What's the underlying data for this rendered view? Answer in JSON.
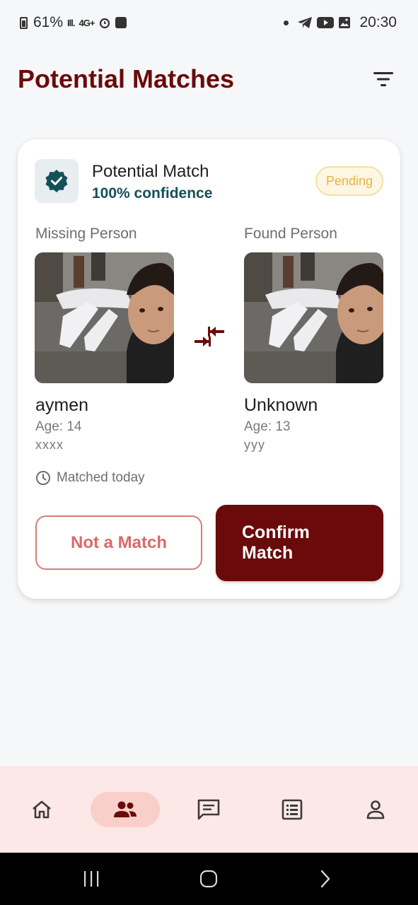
{
  "status_bar": {
    "battery": "61%",
    "signal": "Ill.",
    "network": "4G+",
    "time": "20:30"
  },
  "header": {
    "title": "Potential Matches",
    "filter_icon": "filter-icon"
  },
  "match_card": {
    "title": "Potential Match",
    "confidence": "100% confidence",
    "status": "Pending",
    "missing": {
      "label": "Missing Person",
      "name": "aymen",
      "age": "Age: 14",
      "note": "xxxx"
    },
    "found": {
      "label": "Found Person",
      "name": "Unknown",
      "age": "Age: 13",
      "note": "yyy"
    },
    "matched_time": "Matched today",
    "reject_label": "Not a Match",
    "confirm_label": "Confirm Match"
  },
  "bottom_nav": {
    "items": [
      {
        "icon": "home-icon",
        "active": false
      },
      {
        "icon": "people-icon",
        "active": true
      },
      {
        "icon": "chat-icon",
        "active": false
      },
      {
        "icon": "list-icon",
        "active": false
      },
      {
        "icon": "person-icon",
        "active": false
      }
    ]
  },
  "colors": {
    "brand": "#6b0a0a",
    "accent_teal": "#14505a",
    "pending": "#e9b345",
    "nav_bg": "#fce8e6",
    "nav_active": "#f9cfc9"
  }
}
